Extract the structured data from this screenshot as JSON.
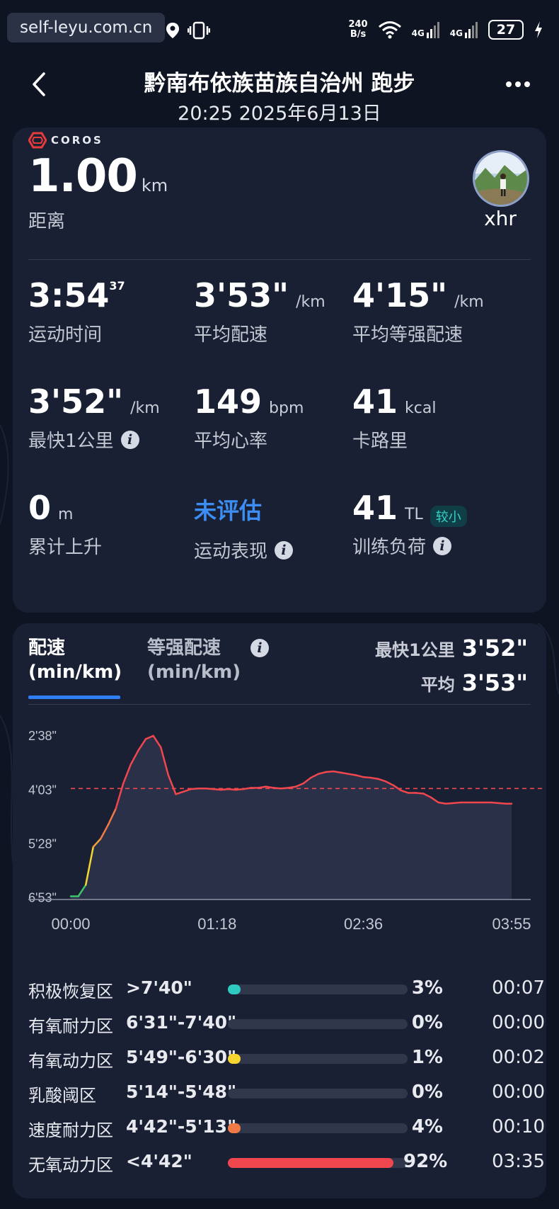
{
  "status_bar": {
    "watermark": "self-leyu.com.cn",
    "net_speed_value": "240",
    "net_speed_unit": "B/s",
    "signal1": "4G",
    "signal2": "4G",
    "battery": "27"
  },
  "header": {
    "title": "黔南布依族苗族自治州 跑步",
    "datetime": "20:25 2025年6月13日"
  },
  "summary": {
    "brand": "COROS",
    "distance_value": "1.00",
    "distance_unit": "km",
    "distance_label": "距离",
    "username": "xhr",
    "stats": [
      {
        "value": "3:54",
        "sup": "37",
        "unit": "",
        "label": "运动时间"
      },
      {
        "value": "3'53\"",
        "unit": "/km",
        "label": "平均配速"
      },
      {
        "value": "4'15\"",
        "unit": "/km",
        "label": "平均等强配速"
      },
      {
        "value": "3'52\"",
        "unit": "/km",
        "label": "最快1公里"
      },
      {
        "value": "149",
        "unit": "bpm",
        "label": "平均心率"
      },
      {
        "value": "41",
        "unit": "kcal",
        "label": "卡路里"
      },
      {
        "value": "0",
        "unit": "m",
        "label": "累计上升"
      },
      {
        "value": "未评估",
        "unit": "",
        "label": "运动表现"
      },
      {
        "value": "41",
        "unit": "TL",
        "badge": "较小",
        "label": "训练负荷"
      }
    ]
  },
  "pace": {
    "tab_active_line1": "配速",
    "tab_active_line2": "(min/km)",
    "tab_inactive_line1": "等强配速",
    "tab_inactive_line2": "(min/km)",
    "fastest_label": "最快1公里",
    "fastest_value": "3'52\"",
    "avg_label": "平均",
    "avg_value": "3'53\""
  },
  "chart_data": {
    "type": "area",
    "ytick_labels": [
      "2'38\"",
      "4'03\"",
      "5'28\"",
      "6'53\""
    ],
    "ytick_seconds": [
      158,
      243,
      328,
      413
    ],
    "xtick_labels": [
      "00:00",
      "01:18",
      "02:36",
      "03:55"
    ],
    "xtick_seconds": [
      0,
      78,
      156,
      235
    ],
    "average_line_seconds": 243,
    "y_inverted": true,
    "series": [
      {
        "x_seconds": [
          0,
          4,
          8,
          12,
          16,
          20,
          24,
          28,
          32,
          36,
          40,
          44,
          48,
          52,
          56,
          60,
          64,
          68,
          72,
          76,
          80,
          84,
          88,
          92,
          96,
          100,
          104,
          108,
          112,
          116,
          120,
          124,
          128,
          132,
          136,
          140,
          144,
          148,
          152,
          156,
          160,
          164,
          168,
          172,
          176,
          180,
          184,
          188,
          192,
          196,
          200,
          204,
          208,
          212,
          216,
          220,
          224,
          228,
          232,
          235
        ],
        "pace_seconds": [
          413,
          413,
          395,
          335,
          322,
          300,
          275,
          235,
          205,
          183,
          165,
          160,
          178,
          222,
          252,
          248,
          244,
          243,
          243,
          244,
          245,
          244,
          245,
          244,
          242,
          242,
          240,
          242,
          243,
          242,
          240,
          235,
          226,
          220,
          217,
          216,
          218,
          220,
          222,
          225,
          226,
          228,
          232,
          238,
          246,
          250,
          250,
          251,
          257,
          265,
          267,
          266,
          265,
          265,
          265,
          265,
          265,
          266,
          267,
          267
        ]
      }
    ]
  },
  "zones": [
    {
      "name": "积极恢复区",
      "range": ">7'40\"",
      "percent": "3%",
      "time": "00:07",
      "color": "#2ec9c0",
      "fraction": 0.03
    },
    {
      "name": "有氧耐力区",
      "range": "6'31\"-7'40\"",
      "percent": "0%",
      "time": "00:00",
      "color": "#3cc46a",
      "fraction": 0
    },
    {
      "name": "有氧动力区",
      "range": "5'49\"-6'30\"",
      "percent": "1%",
      "time": "00:02",
      "color": "#f5d631",
      "fraction": 0.01
    },
    {
      "name": "乳酸阈区",
      "range": "5'14\"-5'48\"",
      "percent": "0%",
      "time": "00:00",
      "color": "#f2a13a",
      "fraction": 0
    },
    {
      "name": "速度耐力区",
      "range": "4'42\"-5'13\"",
      "percent": "4%",
      "time": "00:10",
      "color": "#f07a45",
      "fraction": 0.04
    },
    {
      "name": "无氧动力区",
      "range": "<4'42\"",
      "percent": "92%",
      "time": "03:35",
      "color": "#f0474f",
      "fraction": 0.92
    }
  ]
}
